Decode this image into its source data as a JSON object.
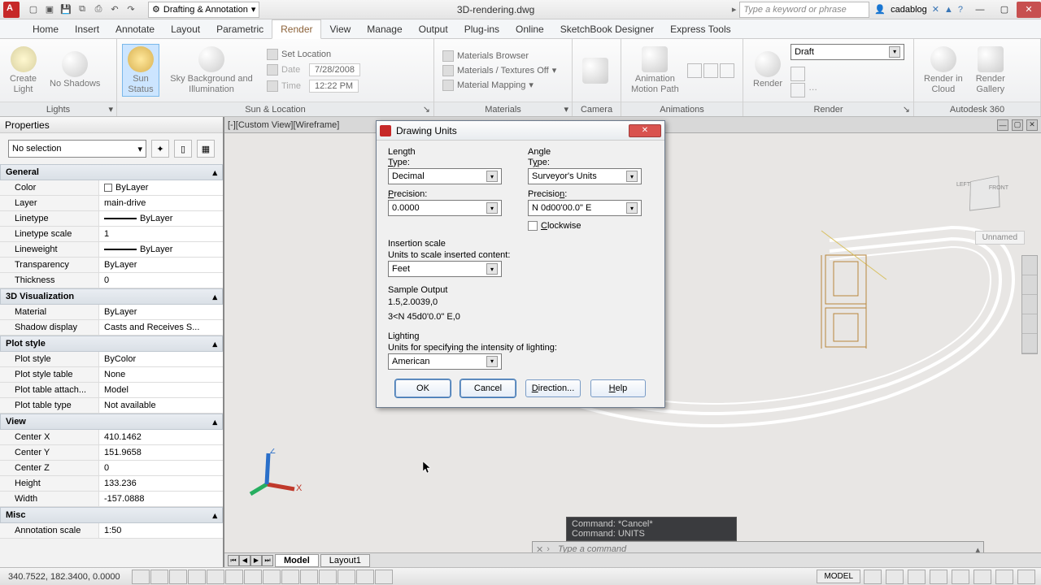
{
  "titlebar": {
    "workspace": "Drafting & Annotation",
    "doc": "3D-rendering.dwg",
    "search_placeholder": "Type a keyword or phrase",
    "user": "cadablog"
  },
  "ribbon_tabs": [
    "Home",
    "Insert",
    "Annotate",
    "Layout",
    "Parametric",
    "Render",
    "View",
    "Manage",
    "Output",
    "Plug-ins",
    "Online",
    "SketchBook Designer",
    "Express Tools"
  ],
  "ribbon_active": "Render",
  "ribbon": {
    "lights": {
      "create": "Create\nLight",
      "noshadows": "No Shadows",
      "title": "Lights"
    },
    "sun": {
      "status": "Sun\nStatus",
      "sky": "Sky Background and Illumination",
      "setlocation": "Set Location",
      "date": "7/28/2008",
      "time": "12:22 PM",
      "title": "Sun & Location"
    },
    "materials": {
      "browser": "Materials Browser",
      "textures": "Materials / Textures Off",
      "mapping": "Material Mapping",
      "title": "Materials"
    },
    "camera": {
      "title": "Camera"
    },
    "animations": {
      "motion": "Animation\nMotion Path",
      "title": "Animations"
    },
    "render": {
      "label": "Render",
      "preset": "Draft",
      "title": "Render"
    },
    "a360": {
      "cloud": "Render in\nCloud",
      "gallery": "Render\nGallery",
      "title": "Autodesk 360"
    }
  },
  "properties": {
    "title": "Properties",
    "selection": "No selection",
    "groups": [
      {
        "name": "General",
        "rows": [
          [
            "Color",
            "ByLayer",
            "swatch"
          ],
          [
            "Layer",
            "main-drive",
            ""
          ],
          [
            "Linetype",
            "ByLayer",
            "line"
          ],
          [
            "Linetype scale",
            "1",
            ""
          ],
          [
            "Lineweight",
            "ByLayer",
            "line"
          ],
          [
            "Transparency",
            "ByLayer",
            ""
          ],
          [
            "Thickness",
            "0",
            ""
          ]
        ]
      },
      {
        "name": "3D Visualization",
        "rows": [
          [
            "Material",
            "ByLayer",
            ""
          ],
          [
            "Shadow display",
            "Casts and Receives S...",
            ""
          ]
        ]
      },
      {
        "name": "Plot style",
        "rows": [
          [
            "Plot style",
            "ByColor",
            ""
          ],
          [
            "Plot style table",
            "None",
            ""
          ],
          [
            "Plot table attach...",
            "Model",
            ""
          ],
          [
            "Plot table type",
            "Not available",
            ""
          ]
        ]
      },
      {
        "name": "View",
        "rows": [
          [
            "Center X",
            "410.1462",
            ""
          ],
          [
            "Center Y",
            "151.9658",
            ""
          ],
          [
            "Center Z",
            "0",
            ""
          ],
          [
            "Height",
            "133.236",
            ""
          ],
          [
            "Width",
            "-157.0888",
            ""
          ]
        ]
      },
      {
        "name": "Misc",
        "rows": [
          [
            "Annotation scale",
            "1:50",
            ""
          ]
        ]
      }
    ]
  },
  "viewport": {
    "label": "[-][Custom View][Wireframe]",
    "unnamed": "Unnamed",
    "tabs": [
      "Model",
      "Layout1"
    ],
    "cmd_history": [
      "Command: *Cancel*",
      "Command: UNITS"
    ],
    "cmd_placeholder": "Type a command"
  },
  "dialog": {
    "title": "Drawing Units",
    "length": {
      "title": "Length",
      "type_label": "Type:",
      "type": "Decimal",
      "precision_label": "Precision:",
      "precision": "0.0000"
    },
    "angle": {
      "title": "Angle",
      "type_label": "Type:",
      "type": "Surveyor's Units",
      "precision_label": "Precision:",
      "precision": "N 0d00'00.0\" E",
      "clockwise": "Clockwise"
    },
    "insertion": {
      "title": "Insertion scale",
      "label": "Units to scale inserted content:",
      "value": "Feet"
    },
    "sample": {
      "title": "Sample Output",
      "line1": "1.5,2.0039,0",
      "line2": "3<N 45d0'0.0\" E,0"
    },
    "lighting": {
      "title": "Lighting",
      "label": "Units for specifying the intensity of lighting:",
      "value": "American"
    },
    "buttons": {
      "ok": "OK",
      "cancel": "Cancel",
      "direction": "Direction...",
      "help": "Help"
    }
  },
  "statusbar": {
    "coords": "340.7522, 182.3400, 0.0000",
    "right_tabs": [
      "MODEL"
    ]
  },
  "viewcube": {
    "left": "LEFT",
    "front": "FRONT"
  }
}
